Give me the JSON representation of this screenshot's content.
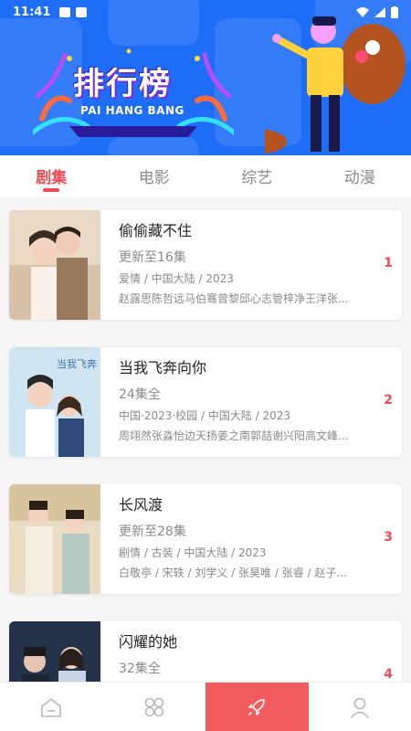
{
  "status": {
    "time": "11:41"
  },
  "banner": {
    "title": "排行榜",
    "subtitle": "PAI HANG BANG"
  },
  "tabs": [
    {
      "label": "剧集",
      "active": true
    },
    {
      "label": "电影",
      "active": false
    },
    {
      "label": "综艺",
      "active": false
    },
    {
      "label": "动漫",
      "active": false
    }
  ],
  "items": [
    {
      "title": "偷偷藏不住",
      "episodes": "更新至16集",
      "meta": "爱情 / 中国大陆 / 2023",
      "cast": "赵露思陈哲远马伯骞曾黎邱心志管梓净王洋张...",
      "rank": "1"
    },
    {
      "title": "当我飞奔向你",
      "episodes": "24集全",
      "meta": "中国·2023·校园 / 中国大陆 / 2023",
      "cast": "周翊然张淼怡边天扬姜之南郭喆谢兴阳高文峰...",
      "rank": "2"
    },
    {
      "title": "长风渡",
      "episodes": "更新至28集",
      "meta": "剧情 / 古装 / 中国大陆 / 2023",
      "cast": "白敬亭 / 宋轶 / 刘学义 / 张昊唯 / 张睿 / 赵子...",
      "rank": "3"
    },
    {
      "title": "闪耀的她",
      "episodes": "32集全",
      "meta": "",
      "cast": "",
      "rank": "4"
    }
  ],
  "colors": {
    "accent": "#ee4b55",
    "banner": "#1e6df6",
    "nav_active": "#f25c5f"
  },
  "nav": [
    "home-icon",
    "category-icon",
    "rocket-icon",
    "profile-icon"
  ]
}
